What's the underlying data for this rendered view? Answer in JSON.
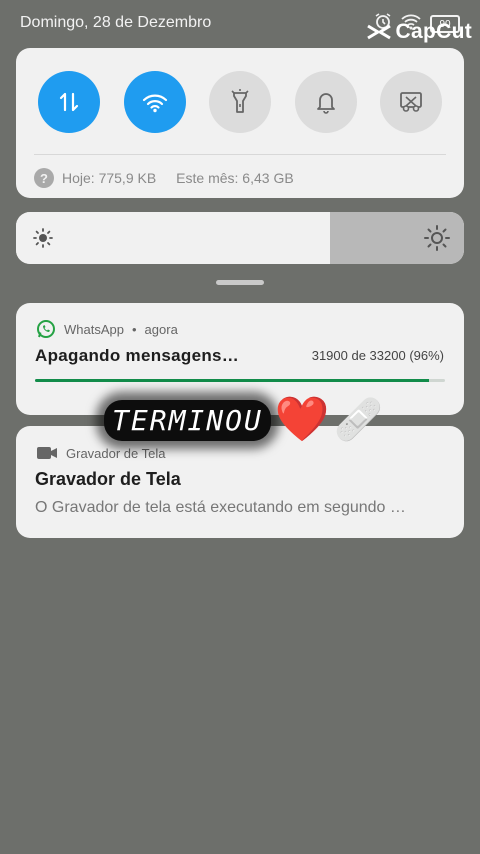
{
  "status_bar": {
    "date": "Domingo, 28 de Dezembro",
    "battery": "90",
    "watermark": "CapCut"
  },
  "quick_settings": {
    "tiles": [
      {
        "name": "mobile-data",
        "icon": "data-arrows-icon",
        "active": true
      },
      {
        "name": "wifi",
        "icon": "wifi-icon",
        "active": true
      },
      {
        "name": "flashlight",
        "icon": "flashlight-icon",
        "active": false
      },
      {
        "name": "sound",
        "icon": "bell-icon",
        "active": false
      },
      {
        "name": "screenshot",
        "icon": "scissors-screen-icon",
        "active": false
      }
    ],
    "data_today": "Hoje: 775,9 KB",
    "data_month": "Este mês: 6,43 GB"
  },
  "brightness": {
    "level": 0.7
  },
  "notifications": {
    "whatsapp": {
      "app": "WhatsApp",
      "time": "agora",
      "title": "Apagando mensagens…",
      "progress_text": "31900 de 33200 (96%)",
      "progress": 0.96,
      "accent": "#128c4a"
    },
    "recorder": {
      "app": "Gravador de Tela",
      "title": "Gravador de Tela",
      "text": "O Gravador de tela está executando em segundo …"
    }
  },
  "overlay": {
    "sticker_text": "TERMINOU",
    "emojis": [
      "❤️",
      "🩹"
    ]
  }
}
